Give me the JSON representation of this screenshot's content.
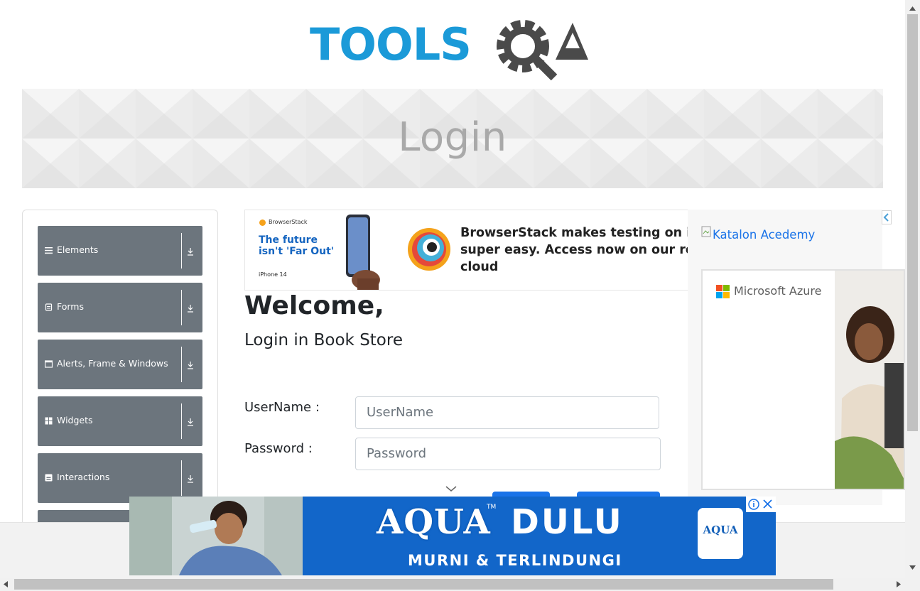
{
  "logo": {
    "text_left": "TOOLS",
    "text_right": "QA"
  },
  "banner": {
    "title": "Login"
  },
  "sidebar": {
    "groups": [
      {
        "label": "Elements",
        "icon": "list-icon"
      },
      {
        "label": "Forms",
        "icon": "form-icon"
      },
      {
        "label": "Alerts, Frame & Windows",
        "icon": "window-icon"
      },
      {
        "label": "Widgets",
        "icon": "widgets-icon"
      },
      {
        "label": "Interactions",
        "icon": "interactions-icon"
      }
    ]
  },
  "top_ad": {
    "brand": "BrowserStack",
    "headline": "The future isn't 'Far Out'",
    "device": "iPhone 14",
    "body_line1": "BrowserStack makes testing on iPho",
    "body_line2": "super easy. Access now on our real",
    "body_line3": "cloud"
  },
  "main": {
    "welcome": "Welcome,",
    "subtitle": "Login in Book Store",
    "username_label": "UserName :",
    "username_placeholder": "UserName",
    "password_label": "Password :",
    "password_placeholder": "Password"
  },
  "right_ad": {
    "katalon_alt": "Katalon Acedemy",
    "azure_brand": "Microsoft Azure"
  },
  "bottom_ad": {
    "word1": "AQUA",
    "tm": "TM",
    "word2": "DULU",
    "tagline": "MURNI & TERLINDUNGI",
    "badge": "AQUA"
  },
  "colors": {
    "tools_blue": "#1b9ad8",
    "qa_gray": "#4a4a4a",
    "sidebar_gray": "#6c757d",
    "link_blue": "#1a73e8",
    "aqua_blue": "#1266c9"
  }
}
